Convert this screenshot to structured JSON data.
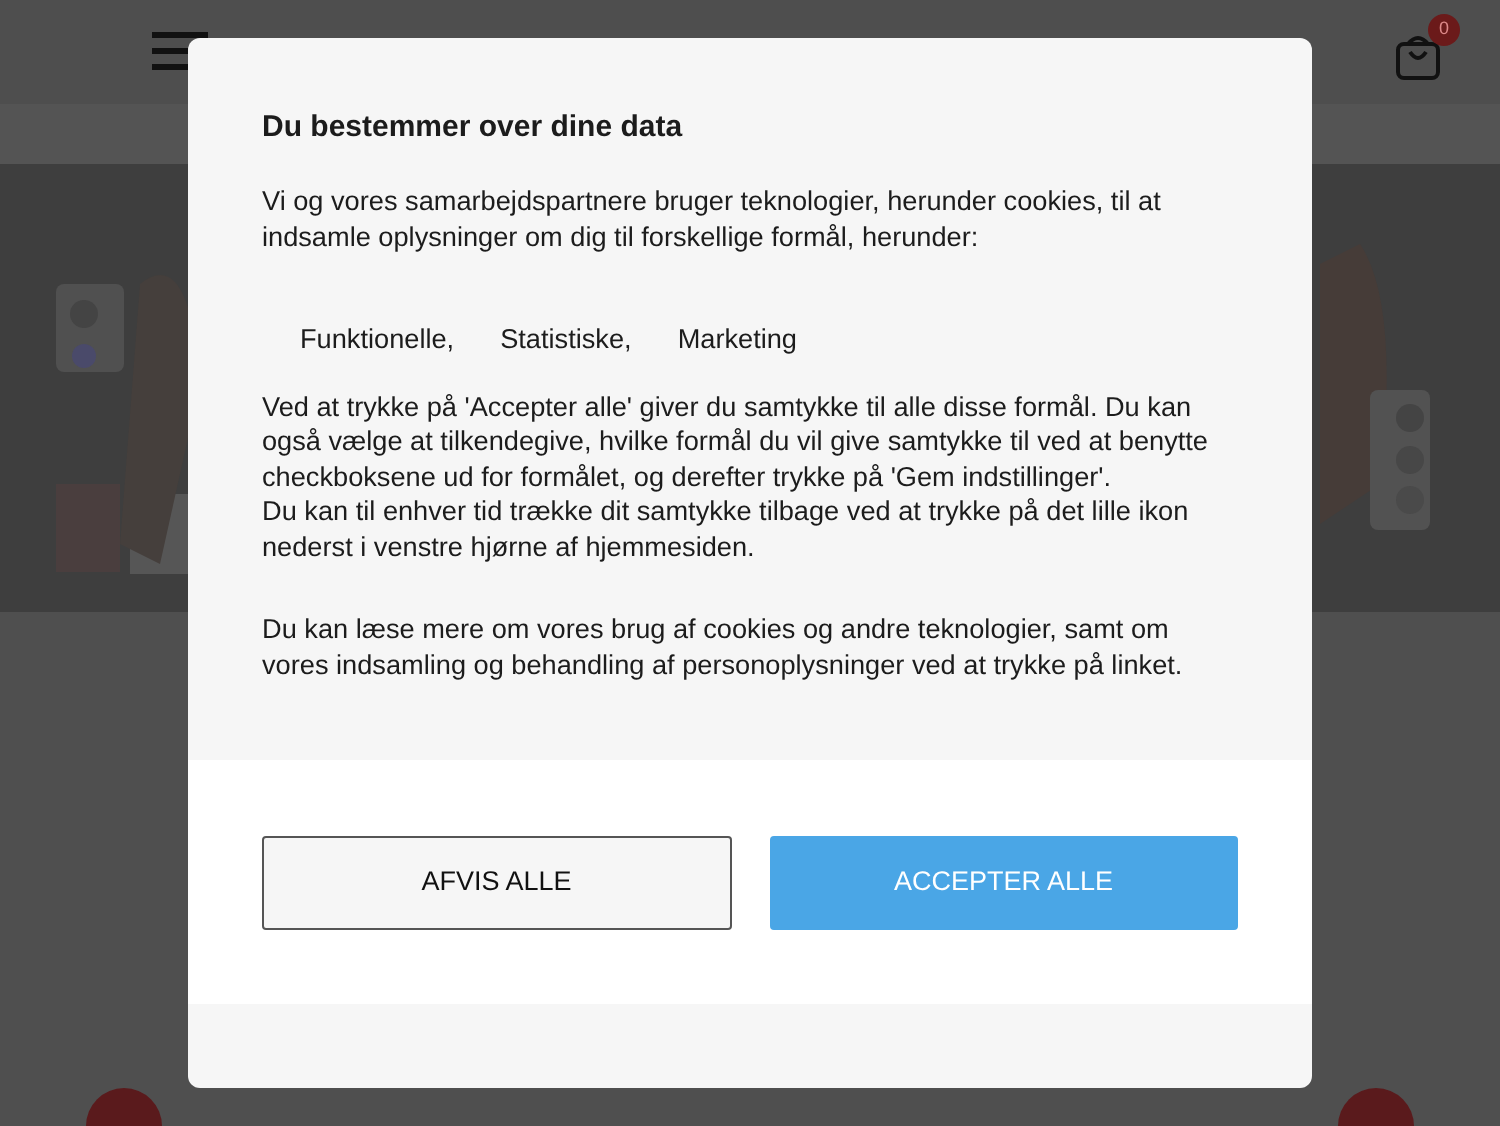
{
  "header": {
    "cart_count": "0"
  },
  "dialog": {
    "title": "Du bestemmer over dine data",
    "intro": "Vi og vores samarbejdspartnere bruger teknologier, herunder cookies, til at indsamle oplysninger om dig til forskellige formål, herunder:",
    "purposes": [
      "Funktionelle,",
      "Statistiske,",
      "Marketing"
    ],
    "paragraphs": [
      "Ved at trykke på 'Accepter alle' giver du samtykke til alle disse formål. Du kan også vælge at tilkendegive, hvilke formål du vil give samtykke til ved at benytte checkboksene ud for formålet, og derefter trykke på 'Gem indstillinger'.",
      "Du kan til enhver tid trække dit samtykke tilbage ved at trykke på det lille ikon nederst i venstre hjørne af hjemmesiden."
    ],
    "more": "Du kan læse mere om vores brug af cookies og andre teknologier, samt om vores indsamling og behandling af personoplysninger ved at trykke på linket.",
    "buttons": [
      {
        "label": "AFVIS ALLE",
        "kind": "secondary"
      },
      {
        "label": "ACCEPTER ALLE",
        "kind": "primary"
      }
    ]
  }
}
